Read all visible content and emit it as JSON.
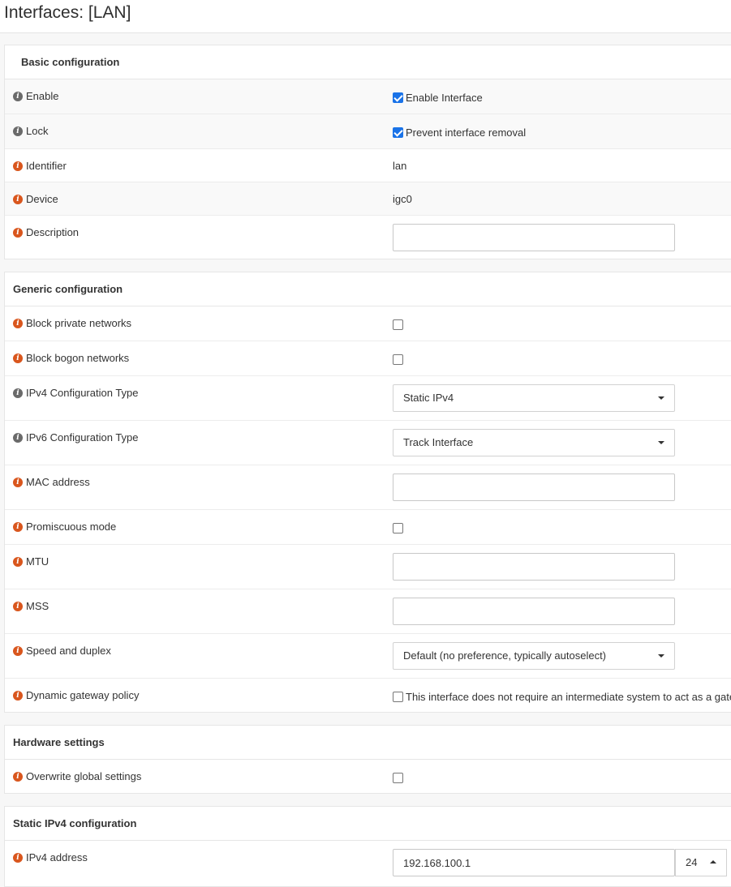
{
  "page": {
    "title": "Interfaces: [LAN]"
  },
  "basic": {
    "title": "Basic configuration",
    "enable": {
      "label": "Enable",
      "checkbox_label": "Enable Interface",
      "checked": true
    },
    "lock": {
      "label": "Lock",
      "checkbox_label": "Prevent interface removal",
      "checked": true
    },
    "identifier": {
      "label": "Identifier",
      "value": "lan"
    },
    "device": {
      "label": "Device",
      "value": "igc0"
    },
    "description": {
      "label": "Description",
      "value": ""
    }
  },
  "generic": {
    "title": "Generic configuration",
    "block_private": {
      "label": "Block private networks",
      "checked": false
    },
    "block_bogon": {
      "label": "Block bogon networks",
      "checked": false
    },
    "ipv4_type": {
      "label": "IPv4 Configuration Type",
      "selected": "Static IPv4"
    },
    "ipv6_type": {
      "label": "IPv6 Configuration Type",
      "selected": "Track Interface"
    },
    "mac": {
      "label": "MAC address",
      "value": ""
    },
    "promisc": {
      "label": "Promiscuous mode",
      "checked": false
    },
    "mtu": {
      "label": "MTU",
      "value": ""
    },
    "mss": {
      "label": "MSS",
      "value": ""
    },
    "speed": {
      "label": "Speed and duplex",
      "selected": "Default (no preference, typically autoselect)"
    },
    "dyn_gw": {
      "label": "Dynamic gateway policy",
      "checkbox_label": "This interface does not require an intermediate system to act as a gate",
      "checked": false
    }
  },
  "hardware": {
    "title": "Hardware settings",
    "overwrite": {
      "label": "Overwrite global settings",
      "checked": false
    }
  },
  "static_ipv4": {
    "title": "Static IPv4 configuration",
    "address": {
      "label": "IPv4 address",
      "value": "192.168.100.1",
      "subnet": "24"
    }
  },
  "colors": {
    "info_gray": "#6a6a6a",
    "info_orange": "#d9561d",
    "checkbox_on": "#1a73e8"
  }
}
